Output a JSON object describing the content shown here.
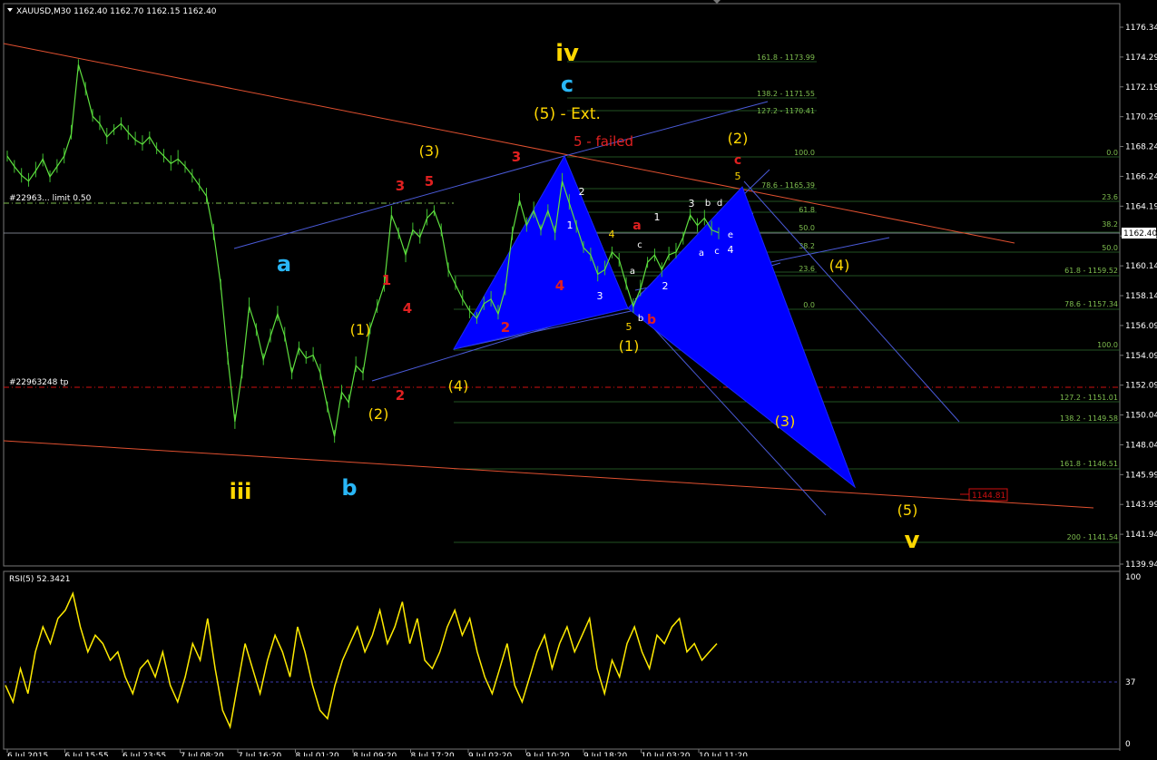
{
  "header": {
    "symbol_line": "XAUUSD,M30  1162.40 1162.70 1162.15 1162.40",
    "indicator_line": "RSI(5) 52.3421"
  },
  "orders": {
    "limit_label": "#22963... limit 0.50",
    "tp_label": "#22963248 tp",
    "price_tag": "1162.40",
    "target_tag": "1144.81"
  },
  "price_axis": {
    "ticks": [
      "1176.34",
      "1174.29",
      "1172.19",
      "1170.29",
      "1168.24",
      "1166.24",
      "1164.19",
      "1162.19",
      "1160.14",
      "1158.14",
      "1156.09",
      "1154.09",
      "1152.09",
      "1150.04",
      "1148.04",
      "1145.99",
      "1143.99",
      "1141.94",
      "1139.94"
    ]
  },
  "rsi_axis": {
    "ticks": [
      "100",
      "37",
      "0"
    ]
  },
  "time_axis": {
    "ticks": [
      "6 Jul 2015",
      "6 Jul 15:55",
      "6 Jul 23:55",
      "7 Jul 08:20",
      "7 Jul 16:20",
      "8 Jul 01:20",
      "8 Jul 09:20",
      "8 Jul 17:20",
      "9 Jul 02:20",
      "9 Jul 10:20",
      "9 Jul 18:20",
      "10 Jul 03:20",
      "10 Jul 11:20"
    ]
  },
  "fib_levels": [
    "161.8 - 1173.99",
    "138.2 - 1171.55",
    "127.2 - 1170.41",
    "100.0",
    "78.6 - 1165.39",
    "61.8",
    "50.0",
    "38.2",
    "23.6",
    "0.0",
    "0.0",
    "23.6",
    "38.2",
    "50.0",
    "61.8 - 1159.52",
    "78.6 - 1157.34",
    "100.0",
    "127.2 - 1151.01",
    "138.2 - 1149.58",
    "161.8 - 1146.51",
    "200 - 1141.54"
  ],
  "wave_labels": {
    "iii": "iii",
    "iv": "iv",
    "v": "v",
    "a": "a",
    "b": "b",
    "c": "c",
    "p1": "(1)",
    "p2": "(2)",
    "p3": "(3)",
    "p4": "(4)",
    "p5": "(5)",
    "p5ext": "(5) - Ext.",
    "failed": "5 - failed",
    "r1": "1",
    "r2": "2",
    "r3": "3",
    "r4": "4",
    "r5": "5",
    "a_small": "a",
    "b_small": "b",
    "c_small": "c",
    "w1": "1",
    "w2": "2",
    "w3": "3",
    "w4": "4",
    "w5": "5",
    "sub_a": "a",
    "sub_b": "b",
    "sub_c": "c",
    "sub_d": "d",
    "sub_e": "e"
  },
  "chart_data": [
    {
      "type": "line",
      "title": "XAUUSD,M30",
      "ylim": [
        1139.94,
        1177.5
      ],
      "y_ticks": [
        1176.34,
        1174.29,
        1172.19,
        1170.29,
        1168.24,
        1166.24,
        1164.19,
        1162.19,
        1160.14,
        1158.14,
        1156.09,
        1154.09,
        1152.09,
        1150.04,
        1148.04,
        1145.99,
        1143.99,
        1141.94,
        1139.94
      ],
      "x_ticks": [
        "6 Jul 2015",
        "6 Jul 15:55",
        "6 Jul 23:55",
        "7 Jul 08:20",
        "7 Jul 16:20",
        "8 Jul 01:20",
        "8 Jul 09:20",
        "8 Jul 17:20",
        "9 Jul 02:20",
        "9 Jul 10:20",
        "9 Jul 18:20",
        "10 Jul 03:20",
        "10 Jul 11:20"
      ],
      "series": [
        {
          "values": [
            1167.6,
            1166.9,
            1166.3,
            1165.9,
            1166.6,
            1167.4,
            1166.2,
            1166.9,
            1167.6,
            1169.1,
            1173.8,
            1172.2,
            1170.3,
            1169.8,
            1168.9,
            1169.4,
            1169.8,
            1169.2,
            1168.7,
            1168.4,
            1168.9,
            1168.1,
            1167.6,
            1167.1,
            1167.4,
            1166.9,
            1166.3,
            1165.6,
            1164.9,
            1162.4,
            1158.9,
            1153.9,
            1149.6,
            1152.9,
            1157.4,
            1155.9,
            1153.8,
            1155.4,
            1156.9,
            1155.4,
            1152.9,
            1154.6,
            1153.9,
            1154.1,
            1152.9,
            1150.6,
            1148.6,
            1151.6,
            1150.9,
            1153.4,
            1152.9,
            1155.9,
            1157.4,
            1158.9,
            1163.6,
            1162.4,
            1160.9,
            1162.6,
            1162.1,
            1163.4,
            1163.9,
            1162.6,
            1159.9,
            1158.9,
            1157.9,
            1157.1,
            1156.6,
            1157.6,
            1157.9,
            1156.9,
            1158.6,
            1162.4,
            1164.6,
            1162.9,
            1163.9,
            1162.6,
            1163.9,
            1162.4,
            1165.9,
            1164.4,
            1162.9,
            1161.4,
            1160.9,
            1159.6,
            1159.9,
            1161.1,
            1160.6,
            1158.9,
            1157.4,
            1158.6,
            1160.4,
            1160.9,
            1159.9,
            1160.9,
            1161.1,
            1162.1,
            1163.6,
            1162.9,
            1163.4,
            1162.6,
            1162.4
          ]
        }
      ]
    },
    {
      "type": "line",
      "title": "RSI(5) 52.3421",
      "ylim": [
        0,
        100
      ],
      "y_ticks": [
        100,
        37,
        0
      ],
      "series": [
        {
          "values": [
            35,
            25,
            45,
            30,
            55,
            70,
            60,
            75,
            80,
            90,
            70,
            55,
            65,
            60,
            50,
            55,
            40,
            30,
            45,
            50,
            40,
            55,
            35,
            25,
            40,
            60,
            50,
            75,
            45,
            20,
            10,
            35,
            60,
            45,
            30,
            50,
            65,
            55,
            40,
            70,
            55,
            35,
            20,
            15,
            35,
            50,
            60,
            70,
            55,
            65,
            80,
            60,
            70,
            85,
            60,
            75,
            50,
            45,
            55,
            70,
            80,
            65,
            75,
            55,
            40,
            30,
            45,
            60,
            35,
            25,
            40,
            55,
            65,
            45,
            60,
            70,
            55,
            65,
            75,
            45,
            30,
            50,
            40,
            60,
            70,
            55,
            45,
            65,
            60,
            70,
            75,
            55,
            60,
            50,
            55,
            60
          ]
        }
      ]
    }
  ]
}
